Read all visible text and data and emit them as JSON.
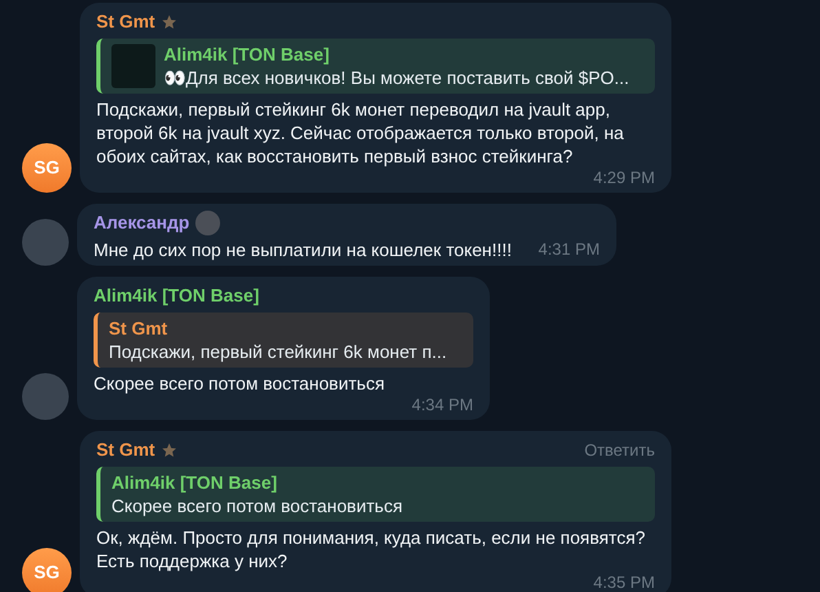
{
  "messages": [
    {
      "sender": "St Gmt",
      "color": "#f0954b",
      "admin_star": true,
      "sender_status_icon": false,
      "avatar": {
        "kind": "initials",
        "text": "SG"
      },
      "reply": {
        "author": "Alim4ik [TON Base]",
        "color": "#6fcf6a",
        "text": "👀Для всех новичков!  Вы можете поставить свой $PO...",
        "thumbnail": true
      },
      "text": "Подскажи, первый стейкинг 6k монет переводил на jvault app, второй 6k на jvault xyz. Сейчас отображается только второй, на обоих сайтах, как восстановить первый взнос стейкинга?",
      "time": "4:29 PM"
    },
    {
      "sender": "Александр",
      "color": "#a695e7",
      "admin_star": false,
      "sender_status_icon": true,
      "avatar": {
        "kind": "photo"
      },
      "text": "Мне до сих пор не выплатили на кошелек токен!!!!",
      "time": "4:31 PM"
    },
    {
      "sender": "Alim4ik [TON Base]",
      "color": "#6fcf6a",
      "admin_star": false,
      "sender_status_icon": false,
      "avatar": {
        "kind": "photo"
      },
      "reply": {
        "author": "St Gmt",
        "color": "#f0954b",
        "text": "Подскажи, первый стейкинг 6k монет п...",
        "thumbnail": false
      },
      "text": "Скорее всего потом востановиться",
      "time": "4:34 PM"
    },
    {
      "sender": "St Gmt",
      "color": "#f0954b",
      "admin_star": true,
      "sender_status_icon": false,
      "avatar": {
        "kind": "initials",
        "text": "SG"
      },
      "reply_action": "Ответить",
      "reply": {
        "author": "Alim4ik [TON Base]",
        "color": "#6fcf6a",
        "text": "Скорее всего потом востановиться",
        "thumbnail": false
      },
      "text": "Ок, ждём. Просто для понимания, куда  писать, если не появятся? Есть поддержка у них?",
      "time": "4:35 PM"
    }
  ]
}
